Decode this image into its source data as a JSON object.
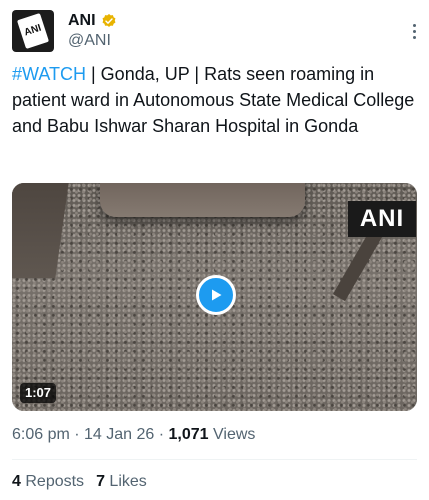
{
  "author": {
    "display_name": "ANI",
    "handle": "@ANI",
    "avatar_text": "ANI",
    "verified_icon": "verified-badge-icon",
    "verified_color": "#e8b300"
  },
  "tweet": {
    "hashtag": "#WATCH",
    "body": " | Gonda, UP | Rats seen roaming in patient ward in Autonomous State Medical College and Babu Ishwar Sharan Hospital in Gonda"
  },
  "media": {
    "watermark": "ANI",
    "duration": "1:07",
    "play_icon": "play-icon",
    "accent": "#1d9bf0"
  },
  "meta": {
    "time": "6:06 pm",
    "separator": " · ",
    "date": "14 Jan 26",
    "views_count": "1,071",
    "views_label": " Views"
  },
  "stats": {
    "reposts_count": "4",
    "reposts_label": "Reposts",
    "likes_count": "7",
    "likes_label": "Likes"
  }
}
